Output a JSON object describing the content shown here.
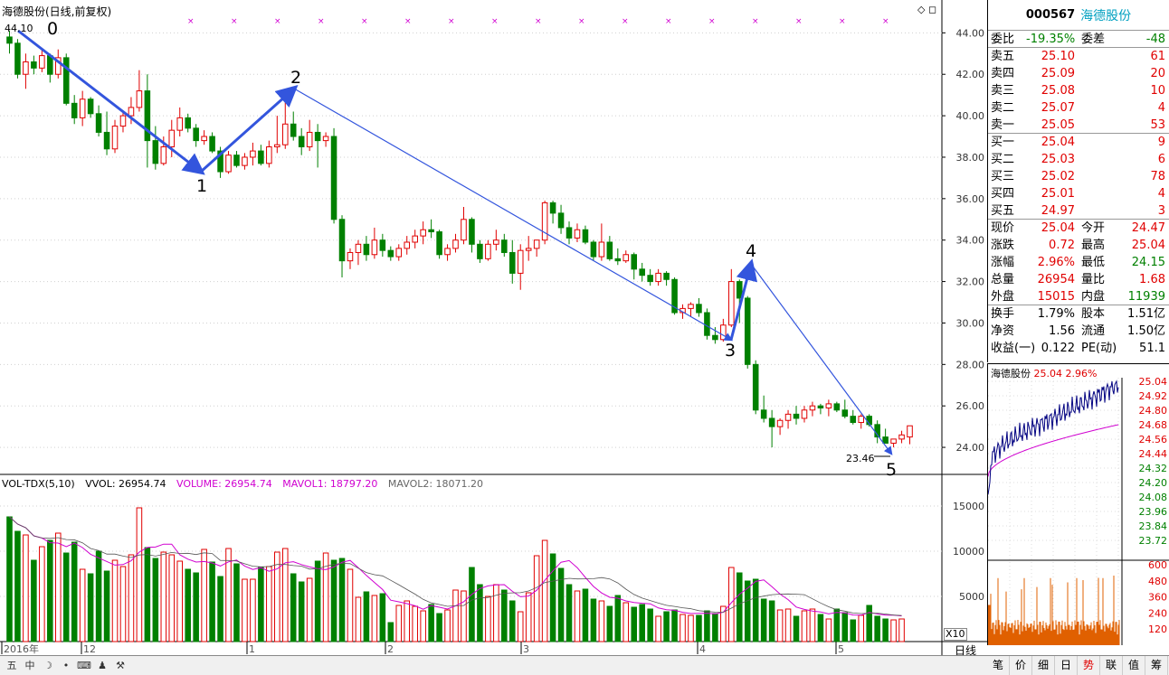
{
  "stock": {
    "code": "000567",
    "name": "海德股份",
    "chart_title": "海德股份(日线,前复权)"
  },
  "price_axis": [
    "44.00",
    "42.00",
    "40.00",
    "38.00",
    "36.00",
    "34.00",
    "32.00",
    "30.00",
    "28.00",
    "26.00",
    "24.00"
  ],
  "vol_axis": [
    "15000",
    "10000",
    "5000"
  ],
  "x10": "X10",
  "daily_btn": "日线",
  "date_labels": [
    "2016年",
    "12",
    "1",
    "2",
    "3",
    "4",
    "5"
  ],
  "markers": {
    "high": "44.10",
    "low": "23.46"
  },
  "waves": [
    "0",
    "1",
    "2",
    "3",
    "4",
    "5"
  ],
  "volume_header": {
    "name": "VOL-TDX(5,10)",
    "vvol": "VVOL: 26954.74",
    "volume": "VOLUME: 26954.74",
    "mavol1": "MAVOL1: 18797.20",
    "mavol2": "MAVOL2: 18071.20"
  },
  "orderbook": {
    "webi_label": "委比",
    "webi_val": "-19.35%",
    "wecha_label": "委差",
    "wecha_val": "-48",
    "sells": [
      {
        "l": "卖五",
        "p": "25.10",
        "v": "61"
      },
      {
        "l": "卖四",
        "p": "25.09",
        "v": "20"
      },
      {
        "l": "卖三",
        "p": "25.08",
        "v": "10"
      },
      {
        "l": "卖二",
        "p": "25.07",
        "v": "4"
      },
      {
        "l": "卖一",
        "p": "25.05",
        "v": "53"
      }
    ],
    "buys": [
      {
        "l": "买一",
        "p": "25.04",
        "v": "9"
      },
      {
        "l": "买二",
        "p": "25.03",
        "v": "6"
      },
      {
        "l": "买三",
        "p": "25.02",
        "v": "78"
      },
      {
        "l": "买四",
        "p": "25.01",
        "v": "4"
      },
      {
        "l": "买五",
        "p": "24.97",
        "v": "3"
      }
    ]
  },
  "quote": [
    {
      "a": "现价",
      "b": "25.04",
      "c": "今开",
      "d": "24.47",
      "bc": "red",
      "dc": "red"
    },
    {
      "a": "涨跌",
      "b": "0.72",
      "c": "最高",
      "d": "25.04",
      "bc": "red",
      "dc": "red"
    },
    {
      "a": "涨幅",
      "b": "2.96%",
      "c": "最低",
      "d": "24.15",
      "bc": "red",
      "dc": "grn"
    },
    {
      "a": "总量",
      "b": "26954",
      "c": "量比",
      "d": "1.68",
      "bc": "red",
      "dc": "red"
    },
    {
      "a": "外盘",
      "b": "15015",
      "c": "内盘",
      "d": "11939",
      "bc": "red",
      "dc": "grn"
    }
  ],
  "quote2": [
    {
      "a": "换手",
      "b": "1.79%",
      "c": "股本",
      "d": "1.51亿"
    },
    {
      "a": "净资",
      "b": "1.56",
      "c": "流通",
      "d": "1.50亿"
    },
    {
      "a": "收益(一)",
      "b": "0.122",
      "c": "PE(动)",
      "d": "51.1"
    }
  ],
  "mini": {
    "title_name": "海德股份",
    "price": "25.04",
    "pct": "2.96%",
    "price_axis": [
      "25.04",
      "24.92",
      "24.80",
      "24.68",
      "24.56",
      "24.44",
      "24.32",
      "24.20",
      "24.08",
      "23.96",
      "23.84",
      "23.72"
    ],
    "vol_axis": [
      "600",
      "480",
      "360",
      "240",
      "120"
    ]
  },
  "tabs": [
    "笔",
    "价",
    "细",
    "日",
    "势",
    "联",
    "值",
    "筹"
  ],
  "active_tab": "势",
  "bottom_icons": [
    "五",
    "中",
    "☽",
    "•",
    "⌨",
    "♟",
    "⚒"
  ],
  "chart_data": {
    "type": "candlestick",
    "title": "海德股份(日线,前复权)",
    "ylim": [
      23.0,
      44.8
    ],
    "annotations": {
      "high": 44.1,
      "low": 23.46
    },
    "wave_points": [
      {
        "label": "0",
        "price": 44.1
      },
      {
        "label": "1",
        "price": 37.0
      },
      {
        "label": "2",
        "price": 40.9
      },
      {
        "label": "3",
        "price": 29.0
      },
      {
        "label": "4",
        "price": 32.6
      },
      {
        "label": "5",
        "price": 23.5
      }
    ],
    "candles": [
      [
        43.8,
        44.1,
        43.0,
        43.5
      ],
      [
        43.5,
        43.7,
        41.8,
        42.0
      ],
      [
        42.0,
        43.0,
        41.3,
        42.6
      ],
      [
        42.6,
        42.9,
        42.0,
        42.3
      ],
      [
        42.3,
        43.2,
        42.1,
        42.9
      ],
      [
        42.9,
        43.0,
        41.6,
        42.0
      ],
      [
        42.0,
        43.2,
        41.8,
        42.8
      ],
      [
        42.8,
        43.0,
        40.5,
        40.6
      ],
      [
        40.6,
        41.0,
        39.6,
        39.9
      ],
      [
        39.9,
        41.2,
        39.5,
        40.8
      ],
      [
        40.8,
        40.9,
        39.9,
        40.1
      ],
      [
        40.1,
        40.5,
        39.0,
        39.2
      ],
      [
        39.2,
        40.2,
        38.1,
        38.4
      ],
      [
        38.4,
        39.8,
        38.2,
        39.5
      ],
      [
        39.5,
        40.2,
        39.2,
        40.0
      ],
      [
        40.0,
        40.9,
        39.6,
        40.4
      ],
      [
        40.4,
        42.2,
        40.2,
        41.2
      ],
      [
        41.2,
        42.0,
        37.5,
        38.8
      ],
      [
        38.8,
        39.5,
        37.4,
        37.7
      ],
      [
        37.7,
        39.0,
        37.6,
        38.5
      ],
      [
        38.5,
        39.8,
        38.0,
        39.3
      ],
      [
        39.3,
        40.4,
        39.0,
        39.9
      ],
      [
        39.9,
        40.1,
        39.2,
        39.4
      ],
      [
        39.4,
        39.6,
        38.5,
        38.8
      ],
      [
        38.8,
        39.3,
        38.6,
        39.0
      ],
      [
        39.0,
        39.2,
        38.2,
        38.3
      ],
      [
        38.3,
        38.5,
        37.0,
        37.3
      ],
      [
        37.3,
        38.3,
        37.2,
        38.1
      ],
      [
        38.1,
        38.3,
        37.5,
        37.6
      ],
      [
        37.6,
        38.2,
        37.4,
        38.0
      ],
      [
        38.0,
        38.7,
        37.6,
        38.3
      ],
      [
        38.3,
        38.6,
        37.6,
        37.7
      ],
      [
        37.7,
        38.8,
        37.5,
        38.5
      ],
      [
        38.5,
        40.0,
        38.2,
        38.6
      ],
      [
        38.6,
        40.9,
        38.4,
        39.6
      ],
      [
        39.6,
        40.2,
        38.8,
        39.0
      ],
      [
        39.0,
        39.4,
        38.1,
        38.5
      ],
      [
        38.5,
        39.8,
        38.3,
        39.2
      ],
      [
        39.2,
        39.6,
        37.5,
        38.8
      ],
      [
        38.8,
        39.2,
        38.5,
        39.0
      ],
      [
        39.0,
        39.4,
        34.8,
        35.0
      ],
      [
        35.0,
        35.2,
        32.2,
        33.0
      ],
      [
        33.0,
        33.6,
        32.6,
        33.4
      ],
      [
        33.4,
        34.0,
        32.8,
        33.8
      ],
      [
        33.8,
        34.2,
        33.0,
        33.3
      ],
      [
        33.3,
        34.6,
        33.1,
        34.0
      ],
      [
        34.0,
        34.3,
        33.2,
        33.5
      ],
      [
        33.5,
        33.7,
        33.0,
        33.2
      ],
      [
        33.2,
        33.8,
        33.0,
        33.6
      ],
      [
        33.6,
        34.2,
        33.3,
        33.9
      ],
      [
        33.9,
        34.5,
        33.6,
        34.2
      ],
      [
        34.2,
        34.9,
        33.8,
        34.5
      ],
      [
        34.5,
        35.0,
        34.1,
        34.4
      ],
      [
        34.4,
        34.5,
        33.1,
        33.3
      ],
      [
        33.3,
        33.8,
        33.0,
        33.6
      ],
      [
        33.6,
        34.3,
        33.4,
        34.0
      ],
      [
        34.0,
        35.6,
        33.8,
        35.0
      ],
      [
        35.0,
        35.1,
        33.4,
        33.8
      ],
      [
        33.8,
        34.0,
        32.9,
        33.1
      ],
      [
        33.1,
        34.0,
        33.0,
        33.8
      ],
      [
        33.8,
        34.5,
        33.5,
        34.0
      ],
      [
        34.0,
        34.3,
        33.2,
        33.4
      ],
      [
        33.4,
        34.0,
        31.9,
        32.4
      ],
      [
        32.4,
        33.8,
        31.6,
        33.5
      ],
      [
        33.5,
        34.2,
        33.0,
        33.6
      ],
      [
        33.6,
        34.0,
        33.2,
        34.0
      ],
      [
        34.0,
        35.9,
        33.8,
        35.8
      ],
      [
        35.8,
        35.9,
        34.8,
        35.3
      ],
      [
        35.3,
        35.7,
        34.3,
        34.6
      ],
      [
        34.6,
        34.9,
        33.8,
        34.1
      ],
      [
        34.1,
        34.8,
        33.9,
        34.5
      ],
      [
        34.5,
        34.7,
        33.8,
        33.9
      ],
      [
        33.9,
        34.0,
        33.0,
        33.2
      ],
      [
        33.2,
        34.8,
        33.0,
        33.9
      ],
      [
        33.9,
        34.2,
        33.0,
        33.1
      ],
      [
        33.1,
        33.6,
        32.8,
        33.0
      ],
      [
        33.0,
        33.5,
        32.9,
        33.3
      ],
      [
        33.3,
        33.4,
        32.1,
        32.6
      ],
      [
        32.6,
        32.9,
        32.0,
        32.3
      ],
      [
        32.3,
        32.6,
        31.8,
        32.0
      ],
      [
        32.0,
        32.6,
        31.8,
        32.4
      ],
      [
        32.4,
        32.5,
        31.8,
        32.1
      ],
      [
        32.1,
        32.2,
        30.4,
        30.5
      ],
      [
        30.5,
        30.9,
        30.2,
        30.7
      ],
      [
        30.7,
        31.0,
        30.3,
        30.9
      ],
      [
        30.9,
        31.2,
        30.3,
        30.5
      ],
      [
        30.5,
        30.7,
        29.2,
        29.4
      ],
      [
        29.4,
        29.8,
        29.0,
        29.2
      ],
      [
        29.2,
        30.2,
        29.1,
        29.9
      ],
      [
        29.9,
        32.6,
        29.8,
        32.0
      ],
      [
        32.0,
        32.1,
        30.0,
        31.2
      ],
      [
        31.2,
        31.3,
        27.8,
        28.0
      ],
      [
        28.0,
        28.2,
        25.6,
        25.8
      ],
      [
        25.8,
        26.5,
        25.2,
        25.4
      ],
      [
        25.4,
        25.8,
        24.0,
        25.0
      ],
      [
        25.0,
        25.4,
        24.6,
        25.3
      ],
      [
        25.3,
        25.8,
        24.9,
        25.6
      ],
      [
        25.6,
        26.0,
        25.1,
        25.4
      ],
      [
        25.4,
        26.0,
        25.2,
        25.8
      ],
      [
        25.8,
        26.2,
        25.5,
        26.0
      ],
      [
        26.0,
        26.1,
        25.6,
        25.9
      ],
      [
        25.9,
        26.3,
        25.5,
        26.1
      ],
      [
        26.1,
        26.2,
        25.7,
        25.8
      ],
      [
        25.8,
        26.3,
        25.4,
        25.5
      ],
      [
        25.5,
        25.8,
        25.1,
        25.2
      ],
      [
        25.2,
        25.6,
        24.9,
        25.5
      ],
      [
        25.5,
        25.6,
        25.0,
        25.1
      ],
      [
        25.1,
        25.3,
        24.2,
        24.5
      ],
      [
        24.5,
        24.9,
        24.3,
        24.2
      ],
      [
        24.2,
        24.4,
        24.0,
        24.4
      ],
      [
        24.4,
        24.8,
        24.2,
        24.6
      ],
      [
        24.5,
        25.04,
        24.15,
        25.04
      ]
    ],
    "volumes": [
      13800,
      12200,
      11800,
      9000,
      10500,
      11200,
      12000,
      9800,
      11000,
      8000,
      7500,
      10000,
      7800,
      9000,
      8300,
      9600,
      14800,
      10400,
      9200,
      9900,
      9600,
      8900,
      8000,
      7600,
      10200,
      8800,
      7200,
      10300,
      8600,
      6900,
      6900,
      8200,
      8300,
      9900,
      10300,
      7500,
      6600,
      7000,
      8900,
      9800,
      9000,
      9200,
      8000,
      4900,
      5500,
      5100,
      5300,
      2100,
      4000,
      4500,
      3900,
      3400,
      4100,
      3100,
      3500,
      5700,
      5600,
      8200,
      6300,
      5000,
      6300,
      5700,
      4500,
      3300,
      5400,
      9500,
      11200,
      9700,
      8100,
      6300,
      5600,
      5800,
      4700,
      4500,
      3900,
      5100,
      4300,
      3800,
      4100,
      3600,
      2800,
      3300,
      3500,
      3000,
      2900,
      2900,
      3400,
      3100,
      3900,
      8200,
      7600,
      6700,
      6900,
      4700,
      4500,
      3500,
      3600,
      2800,
      3400,
      3600,
      3000,
      2500,
      3600,
      3200,
      2400,
      2900,
      4000,
      2800,
      2500,
      2400,
      2500
    ]
  }
}
